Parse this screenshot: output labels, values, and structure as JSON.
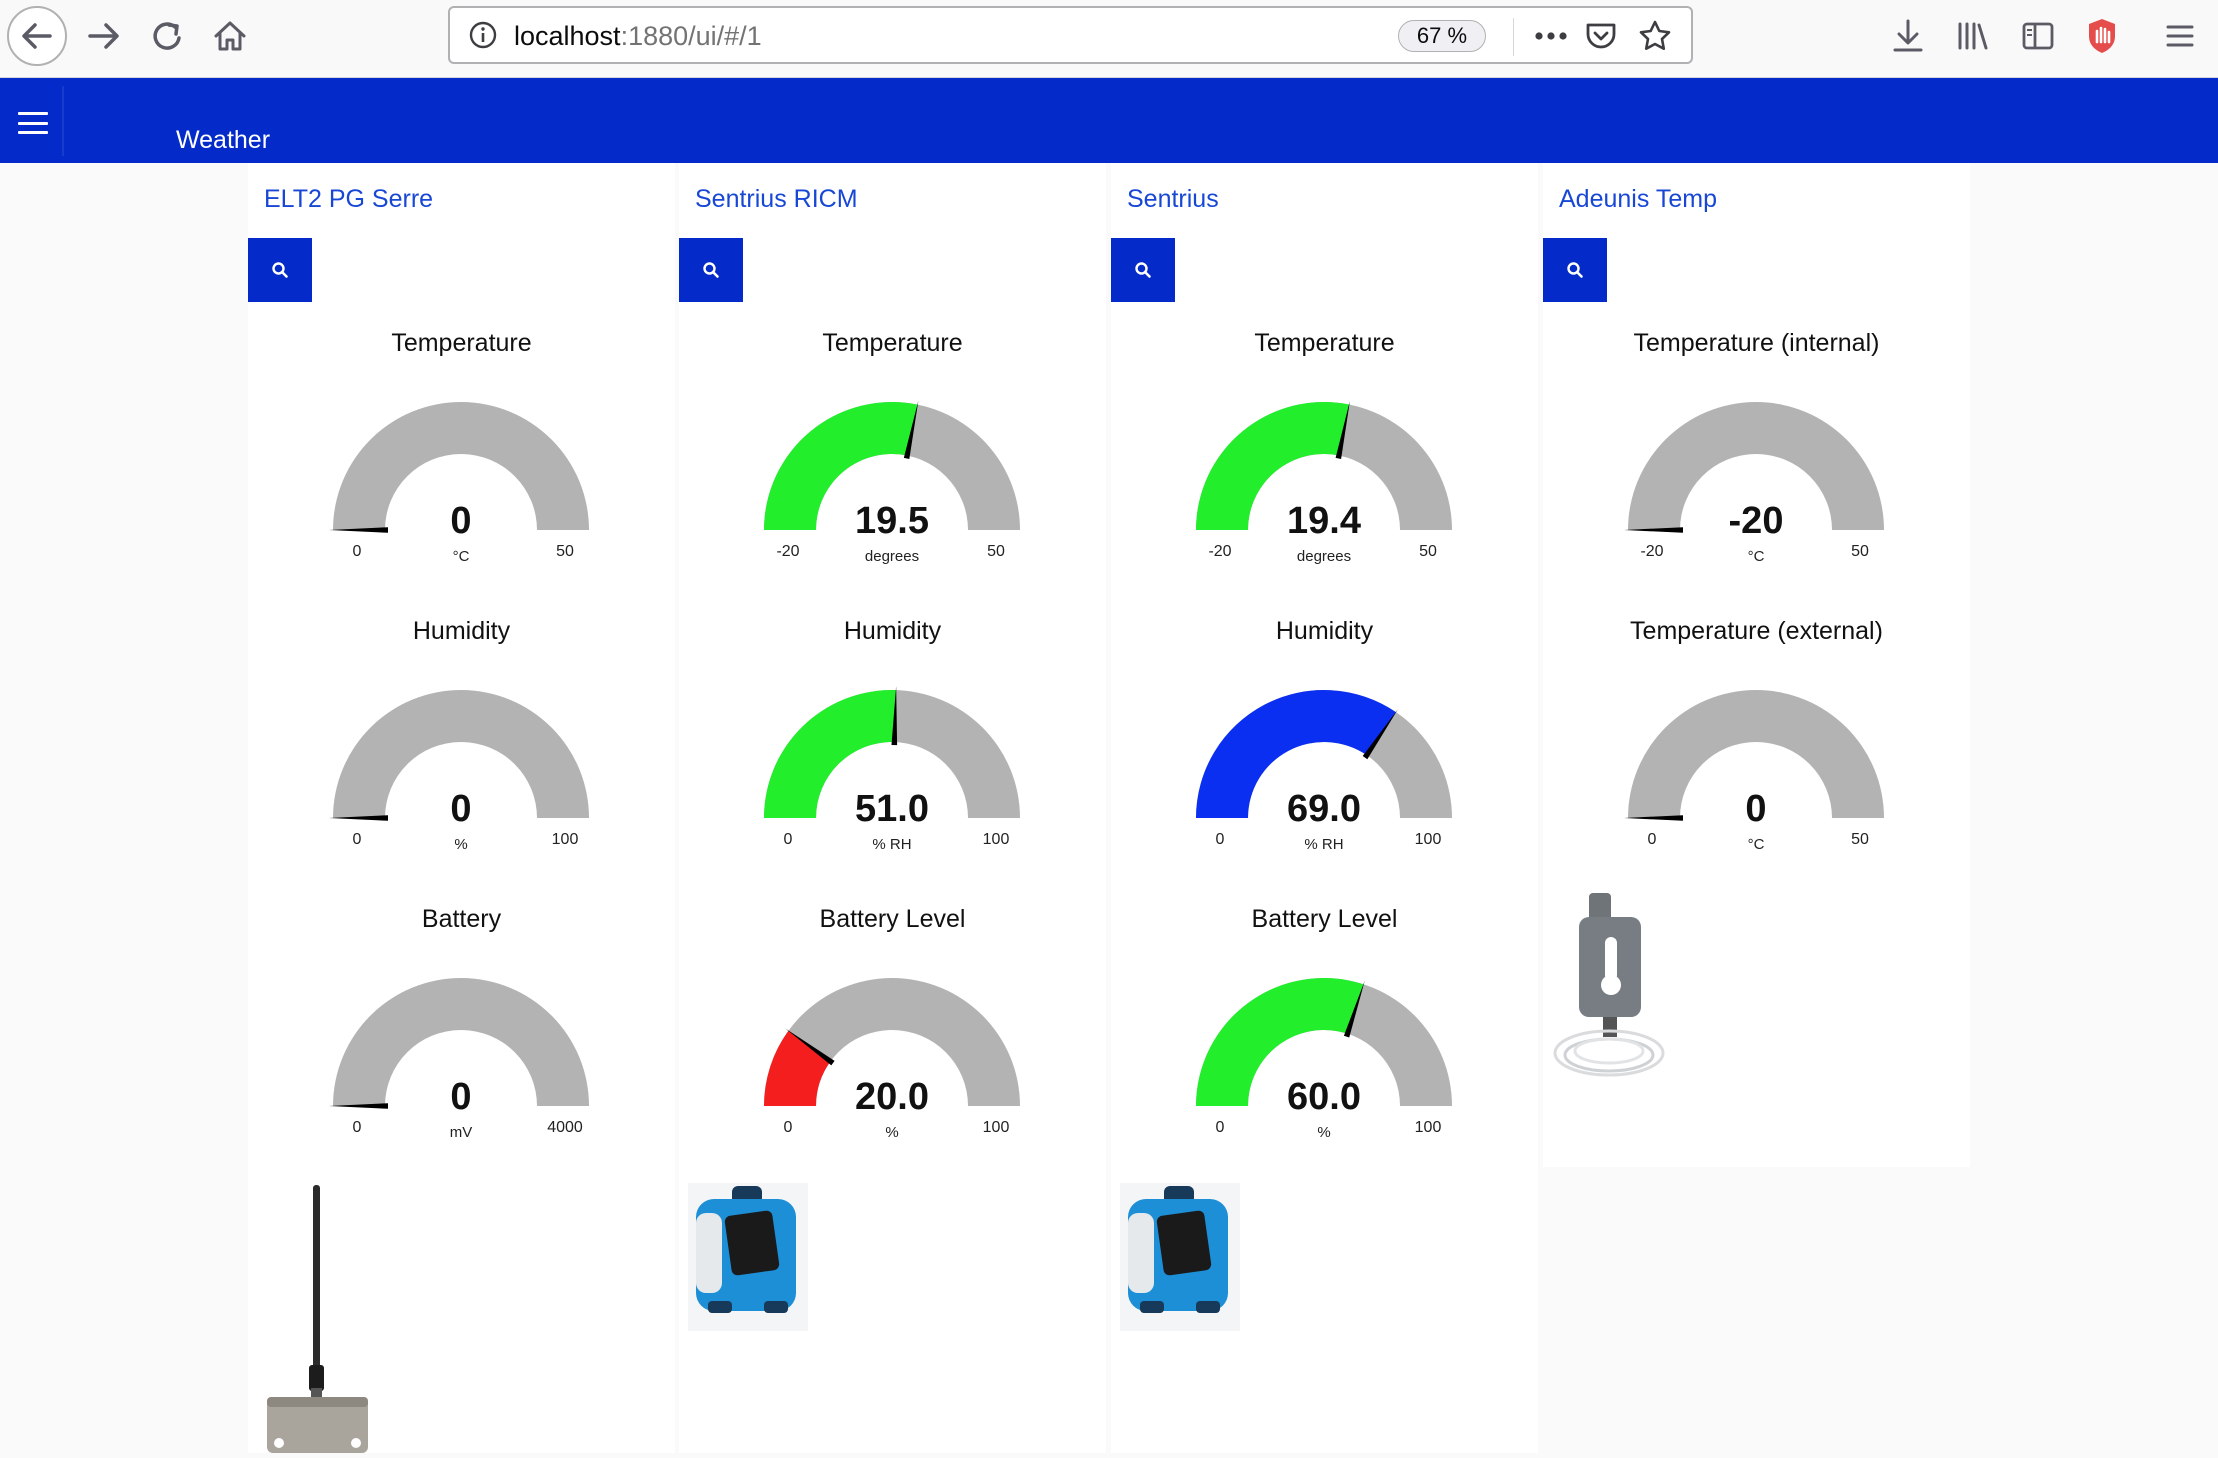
{
  "browser": {
    "url_host": "localhost",
    "url_rest": ":1880/ui/#/1",
    "zoom": "67 %"
  },
  "header": {
    "title": "Weather"
  },
  "colors": {
    "header_bg": "#042bc9",
    "gauge_track": "#b3b3b3",
    "gauge_green": "#22ee2c",
    "gauge_blue": "#0b2ff1",
    "gauge_red": "#f41e1e",
    "group_title": "#1847d6"
  },
  "groups": [
    {
      "title": "ELT2 PG Serre",
      "image": "antenna-sensor",
      "gauges": [
        {
          "label": "Temperature",
          "value": "0",
          "unit": "°C",
          "min": "0",
          "max": "50",
          "fraction": 0,
          "color": "#b3b3b3"
        },
        {
          "label": "Humidity",
          "value": "0",
          "unit": "%",
          "min": "0",
          "max": "100",
          "fraction": 0,
          "color": "#b3b3b3"
        },
        {
          "label": "Battery",
          "value": "0",
          "unit": "mV",
          "min": "0",
          "max": "4000",
          "fraction": 0,
          "color": "#b3b3b3"
        }
      ]
    },
    {
      "title": "Sentrius RICM",
      "image": "laird-sensor",
      "gauges": [
        {
          "label": "Temperature",
          "value": "19.5",
          "unit": "degrees",
          "min": "-20",
          "max": "50",
          "fraction": 0.564,
          "color": "#22ee2c"
        },
        {
          "label": "Humidity",
          "value": "51.0",
          "unit": "% RH",
          "min": "0",
          "max": "100",
          "fraction": 0.51,
          "color": "#22ee2c"
        },
        {
          "label": "Battery Level",
          "value": "20.0",
          "unit": "%",
          "min": "0",
          "max": "100",
          "fraction": 0.2,
          "color": "#f41e1e"
        }
      ]
    },
    {
      "title": "Sentrius",
      "image": "laird-sensor",
      "gauges": [
        {
          "label": "Temperature",
          "value": "19.4",
          "unit": "degrees",
          "min": "-20",
          "max": "50",
          "fraction": 0.563,
          "color": "#22ee2c"
        },
        {
          "label": "Humidity",
          "value": "69.0",
          "unit": "% RH",
          "min": "0",
          "max": "100",
          "fraction": 0.69,
          "color": "#0b2ff1"
        },
        {
          "label": "Battery Level",
          "value": "60.0",
          "unit": "%",
          "min": "0",
          "max": "100",
          "fraction": 0.6,
          "color": "#22ee2c"
        }
      ]
    },
    {
      "title": "Adeunis Temp",
      "image": "adeunis-sensor",
      "gauges": [
        {
          "label": "Temperature (internal)",
          "value": "-20",
          "unit": "°C",
          "min": "-20",
          "max": "50",
          "fraction": 0,
          "color": "#b3b3b3"
        },
        {
          "label": "Temperature (external)",
          "value": "0",
          "unit": "°C",
          "min": "0",
          "max": "50",
          "fraction": 0,
          "color": "#b3b3b3"
        }
      ]
    }
  ]
}
